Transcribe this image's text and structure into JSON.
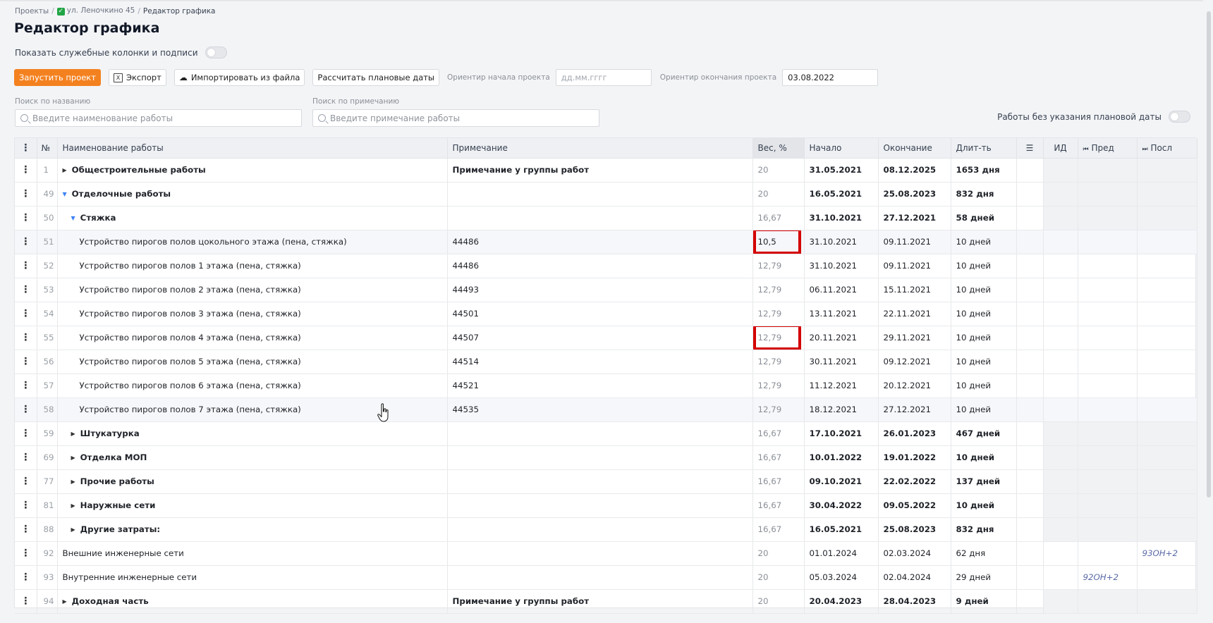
{
  "breadcrumb": {
    "root": "Проекты",
    "project": "ул. Леночкино 45",
    "current": "Редактор графика"
  },
  "page_title": "Редактор графика",
  "show_service_cols_label": "Показать служебные колонки и подписи",
  "toolbar": {
    "start_label": "Запустить проект",
    "export_label": "Экспорт",
    "import_label": "Импортировать из файла",
    "calc_label": "Рассчитать плановые даты",
    "start_orient_label": "Ориентир начала проекта",
    "start_orient_placeholder": "дд.мм.гггг",
    "end_orient_label": "Ориентир окончания проекта",
    "end_orient_value": "03.08.2022"
  },
  "search": {
    "name_label": "Поиск по названию",
    "name_placeholder": "Введите наименование работы",
    "note_label": "Поиск по примечанию",
    "note_placeholder": "Введите примечание работы"
  },
  "no_date_label": "Работы без указания плановой даты",
  "columns": {
    "num": "№",
    "name": "Наименование работы",
    "note": "Примечание",
    "weight": "Вес, %",
    "start": "Начало",
    "end": "Окончание",
    "duration": "Длит-ть",
    "id": "ИД",
    "pred": "Пред",
    "succ": "Посл"
  },
  "rows": [
    {
      "num": "1",
      "name": "Общестроительные работы",
      "note": "Примечание у группы работ",
      "weight": "20",
      "start": "31.05.2021",
      "end": "08.12.2025",
      "duration": "1653 дня",
      "pred": "",
      "succ": ""
    },
    {
      "num": "49",
      "name": "Отделочные работы",
      "note": "",
      "weight": "20",
      "start": "16.05.2021",
      "end": "25.08.2023",
      "duration": "832 дня",
      "pred": "",
      "succ": ""
    },
    {
      "num": "50",
      "name": "Стяжка",
      "note": "",
      "weight": "16,67",
      "start": "31.10.2021",
      "end": "27.12.2021",
      "duration": "58 дней",
      "pred": "",
      "succ": ""
    },
    {
      "num": "51",
      "name": "Устройство пирогов полов цокольного этажа (пена, стяжка)",
      "note": "44486",
      "weight": "10,5",
      "start": "31.10.2021",
      "end": "09.11.2021",
      "duration": "10 дней",
      "pred": "",
      "succ": ""
    },
    {
      "num": "52",
      "name": "Устройство пирогов полов 1 этажа (пена, стяжка)",
      "note": "44486",
      "weight": "12,79",
      "start": "31.10.2021",
      "end": "09.11.2021",
      "duration": "10 дней",
      "pred": "",
      "succ": ""
    },
    {
      "num": "53",
      "name": "Устройство пирогов полов 2 этажа (пена, стяжка)",
      "note": "44493",
      "weight": "12,79",
      "start": "06.11.2021",
      "end": "15.11.2021",
      "duration": "10 дней",
      "pred": "",
      "succ": ""
    },
    {
      "num": "54",
      "name": "Устройство пирогов полов 3 этажа (пена, стяжка)",
      "note": "44501",
      "weight": "12,79",
      "start": "13.11.2021",
      "end": "22.11.2021",
      "duration": "10 дней",
      "pred": "",
      "succ": ""
    },
    {
      "num": "55",
      "name": "Устройство пирогов полов 4 этажа (пена, стяжка)",
      "note": "44507",
      "weight": "12,79",
      "start": "20.11.2021",
      "end": "29.11.2021",
      "duration": "10 дней",
      "pred": "",
      "succ": ""
    },
    {
      "num": "56",
      "name": "Устройство пирогов полов 5 этажа (пена, стяжка)",
      "note": "44514",
      "weight": "12,79",
      "start": "30.11.2021",
      "end": "09.12.2021",
      "duration": "10 дней",
      "pred": "",
      "succ": ""
    },
    {
      "num": "57",
      "name": "Устройство пирогов полов 6 этажа (пена, стяжка)",
      "note": "44521",
      "weight": "12,79",
      "start": "11.12.2021",
      "end": "20.12.2021",
      "duration": "10 дней",
      "pred": "",
      "succ": ""
    },
    {
      "num": "58",
      "name": "Устройство пирогов полов 7 этажа (пена, стяжка)",
      "note": "44535",
      "weight": "12,79",
      "start": "18.12.2021",
      "end": "27.12.2021",
      "duration": "10 дней",
      "pred": "",
      "succ": ""
    },
    {
      "num": "59",
      "name": "Штукатурка",
      "note": "",
      "weight": "16,67",
      "start": "17.10.2021",
      "end": "26.01.2023",
      "duration": "467 дней",
      "pred": "",
      "succ": ""
    },
    {
      "num": "69",
      "name": "Отделка МОП",
      "note": "",
      "weight": "16,67",
      "start": "10.01.2022",
      "end": "19.01.2022",
      "duration": "10 дней",
      "pred": "",
      "succ": ""
    },
    {
      "num": "77",
      "name": "Прочие работы",
      "note": "",
      "weight": "16,67",
      "start": "09.10.2021",
      "end": "22.02.2022",
      "duration": "137 дней",
      "pred": "",
      "succ": ""
    },
    {
      "num": "81",
      "name": "Наружные сети",
      "note": "",
      "weight": "16,67",
      "start": "30.04.2022",
      "end": "09.05.2022",
      "duration": "10 дней",
      "pred": "",
      "succ": ""
    },
    {
      "num": "88",
      "name": "Другие затраты:",
      "note": "",
      "weight": "16,67",
      "start": "16.05.2021",
      "end": "25.08.2023",
      "duration": "832 дня",
      "pred": "",
      "succ": ""
    },
    {
      "num": "92",
      "name": "Внешние инженерные сети",
      "note": "",
      "weight": "20",
      "start": "01.01.2024",
      "end": "02.03.2024",
      "duration": "62 дня",
      "pred": "",
      "succ": "93ОН+2"
    },
    {
      "num": "93",
      "name": "Внутренние инженерные сети",
      "note": "",
      "weight": "20",
      "start": "05.03.2024",
      "end": "02.04.2024",
      "duration": "29 дней",
      "pred": "92ОН+2",
      "succ": ""
    },
    {
      "num": "94",
      "name": "Доходная часть",
      "note": "Примечание у группы работ",
      "weight": "20",
      "start": "20.04.2023",
      "end": "28.04.2023",
      "duration": "9 дней",
      "pred": "",
      "succ": ""
    }
  ]
}
